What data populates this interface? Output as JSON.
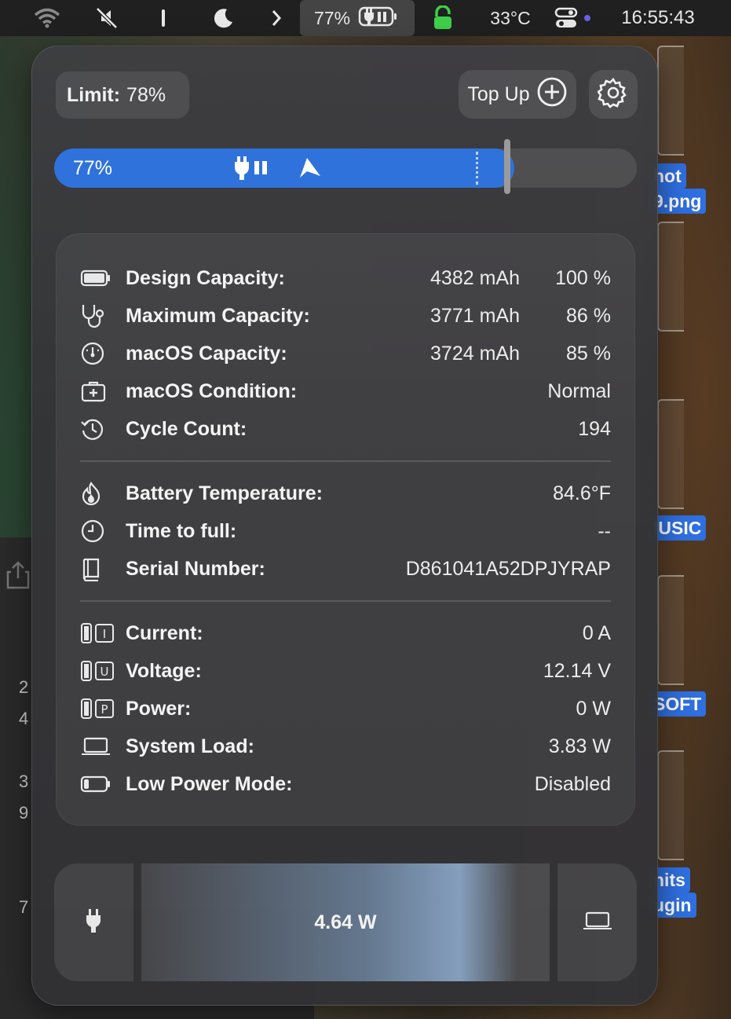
{
  "menubar": {
    "items": [
      "wifi-icon",
      "mute-icon",
      "bar-icon",
      "moon-icon",
      "chevron-right-icon"
    ],
    "battery_percent": "77%",
    "temperature": "33°C",
    "clock": "16:55:43"
  },
  "desktop": {
    "labels": [
      "hot",
      "9.png",
      "IUSIC",
      "SOFT",
      "nits",
      "ugin"
    ],
    "window_numbers": [
      "2",
      "4",
      "3",
      "9",
      "7"
    ]
  },
  "popover": {
    "limit": {
      "label": "Limit:",
      "value": "78%"
    },
    "topup_label": "Top Up",
    "charge": {
      "percent_label": "77%",
      "level": 0.77,
      "limit": 0.78
    },
    "info": {
      "design_capacity": {
        "label": "Design Capacity:",
        "mah": "4382 mAh",
        "pct": "100 %"
      },
      "maximum_capacity": {
        "label": "Maximum Capacity:",
        "mah": "3771 mAh",
        "pct": "86 %"
      },
      "macos_capacity": {
        "label": "macOS Capacity:",
        "mah": "3724 mAh",
        "pct": "85 %"
      },
      "macos_condition": {
        "label": "macOS Condition:",
        "value": "Normal"
      },
      "cycle_count": {
        "label": "Cycle Count:",
        "value": "194"
      },
      "battery_temperature": {
        "label": "Battery Temperature:",
        "value": "84.6°F"
      },
      "time_to_full": {
        "label": "Time to full:",
        "value": "--"
      },
      "serial_number": {
        "label": "Serial Number:",
        "value": "D861041A52DPJYRAP"
      },
      "current": {
        "label": "Current:",
        "value": "0 A",
        "badge": "I"
      },
      "voltage": {
        "label": "Voltage:",
        "value": "12.14 V",
        "badge": "U"
      },
      "power": {
        "label": "Power:",
        "value": "0 W",
        "badge": "P"
      },
      "system_load": {
        "label": "System Load:",
        "value": "3.83 W"
      },
      "low_power_mode": {
        "label": "Low Power Mode:",
        "value": "Disabled"
      }
    },
    "flow": {
      "value": "4.64 W"
    }
  },
  "colors": {
    "accent_blue": "#2f72db",
    "lock_green": "#3fcf4a"
  }
}
